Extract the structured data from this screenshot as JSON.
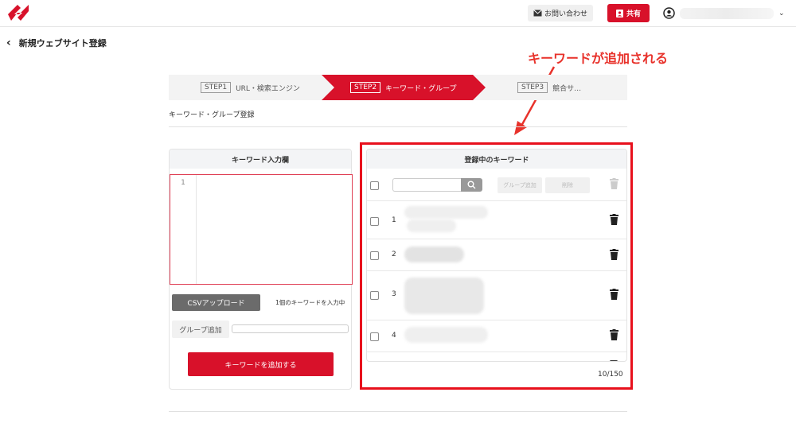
{
  "header": {
    "contact_label": "お問い合わせ",
    "share_label": "共有"
  },
  "page": {
    "title": "新規ウェブサイト登録"
  },
  "annotation": {
    "text": "キーワードが追加される",
    "color": "#e8322b"
  },
  "steps": [
    {
      "tag": "STEP1",
      "label": "URL・検索エンジン",
      "active": false
    },
    {
      "tag": "STEP2",
      "label": "キーワード・グループ",
      "active": true
    },
    {
      "tag": "STEP3",
      "label": "競合サ…",
      "active": false
    }
  ],
  "section_label": "キーワード・グループ登録",
  "left_panel": {
    "header": "キーワード入力欄",
    "line_number": "1",
    "csv_button": "CSVアップロード",
    "count_text": "1個のキーワードを入力中",
    "group_add_label": "グループ追加",
    "add_button": "キーワードを追加する"
  },
  "right_panel": {
    "header": "登録中のキーワード",
    "group_add_button": "グループ追加",
    "delete_button": "削除",
    "rows": [
      {
        "num": "1"
      },
      {
        "num": "2"
      },
      {
        "num": "3"
      },
      {
        "num": "4"
      }
    ],
    "count": "10/150"
  },
  "colors": {
    "brand_red": "#d8112a",
    "highlight_border": "#e8101c"
  },
  "icons": {
    "logo": "brand-logo-icon",
    "mail": "mail-icon",
    "share": "share-icon",
    "user": "user-icon",
    "back": "chevron-left-icon",
    "search": "search-icon",
    "trash": "trash-icon"
  }
}
